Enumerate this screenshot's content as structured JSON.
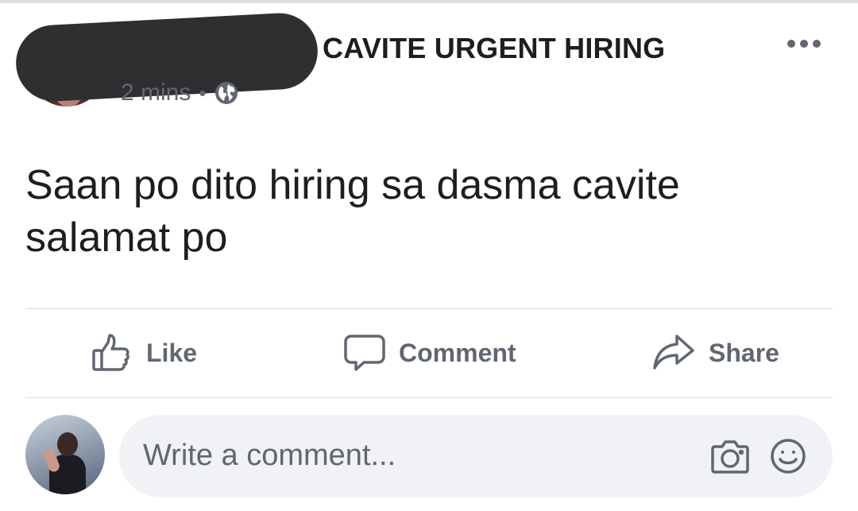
{
  "post": {
    "group_name": "CAVITE URGENT HIRING",
    "timestamp": "2 mins",
    "separator": "•",
    "audience_icon": "globe-icon",
    "more_icon": "more-options-icon",
    "text": "Saan po dito hiring sa dasma cavite salamat po"
  },
  "actions": {
    "like_label": "Like",
    "comment_label": "Comment",
    "share_label": "Share",
    "icon_color": "#606770"
  },
  "comment_composer": {
    "placeholder": "Write a comment...",
    "camera_icon": "camera-icon",
    "emoji_icon": "emoji-icon",
    "background": "#f0f2f5"
  }
}
